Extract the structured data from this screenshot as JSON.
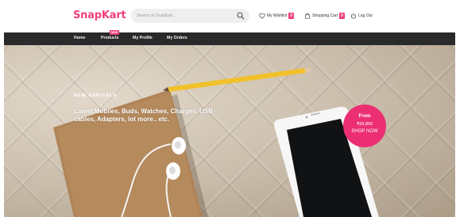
{
  "header": {
    "brand": "SnapKart",
    "search_placeholder": "Search on SnapKart...",
    "wishlist_label": "My Wishlist",
    "wishlist_count": "0",
    "cart_label": "Shopping Cart",
    "cart_count": "0",
    "logout_label": "Log Out"
  },
  "nav": {
    "items": [
      "Home",
      "Products",
      "My Profile",
      "My Orders"
    ],
    "new_tag": "NEW"
  },
  "hero": {
    "eyebrow": "NEW ARRIVALS",
    "text": "Latest Mobiles, Buds, Watches, Charges, USB cables, Adapters, lot more.. etc.",
    "promo": {
      "from": "From",
      "price": "₹69,800",
      "cta": "SHOP NOW"
    }
  },
  "colors": {
    "brand": "#f0407a",
    "nav_bg": "#2a2a2c",
    "promo_bg": "#ec2f72"
  }
}
